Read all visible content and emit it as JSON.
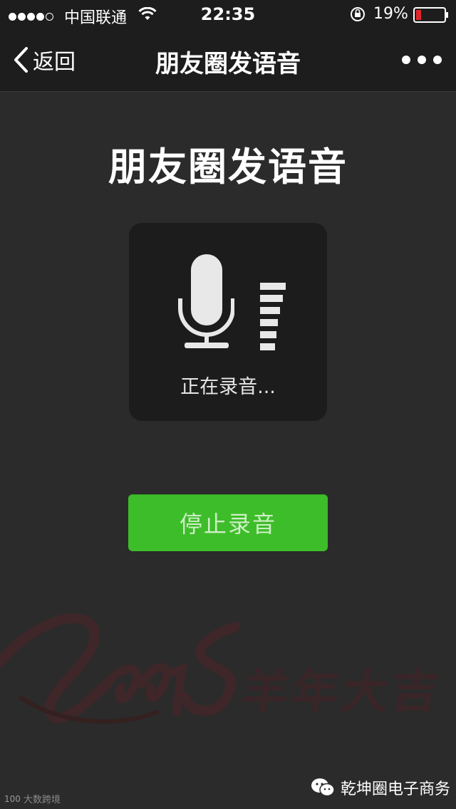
{
  "status_bar": {
    "carrier": "中国联通",
    "time": "22:35",
    "battery": "19%",
    "signal_bars_filled": 4,
    "signal_bars_total": 5,
    "battery_level": 0.19
  },
  "nav": {
    "back_label": "返回",
    "title": "朋友圈发语音",
    "more_icon": "more-dots-icon"
  },
  "main": {
    "heading": "朋友圈发语音",
    "recording_status": "正在录音...",
    "stop_button_label": "停止录音"
  },
  "decoration": {
    "year": "2015",
    "greeting": "羊年大吉"
  },
  "watermark": {
    "left_text": "大数跨境",
    "left_logo": "100",
    "right_text": "乾坤圈电子商务"
  },
  "colors": {
    "background": "#2b2b2b",
    "bar": "#1d1d1d",
    "panel": "#1c1c1c",
    "button_green": "#3ebd2a",
    "battery_red": "#e0262a"
  }
}
